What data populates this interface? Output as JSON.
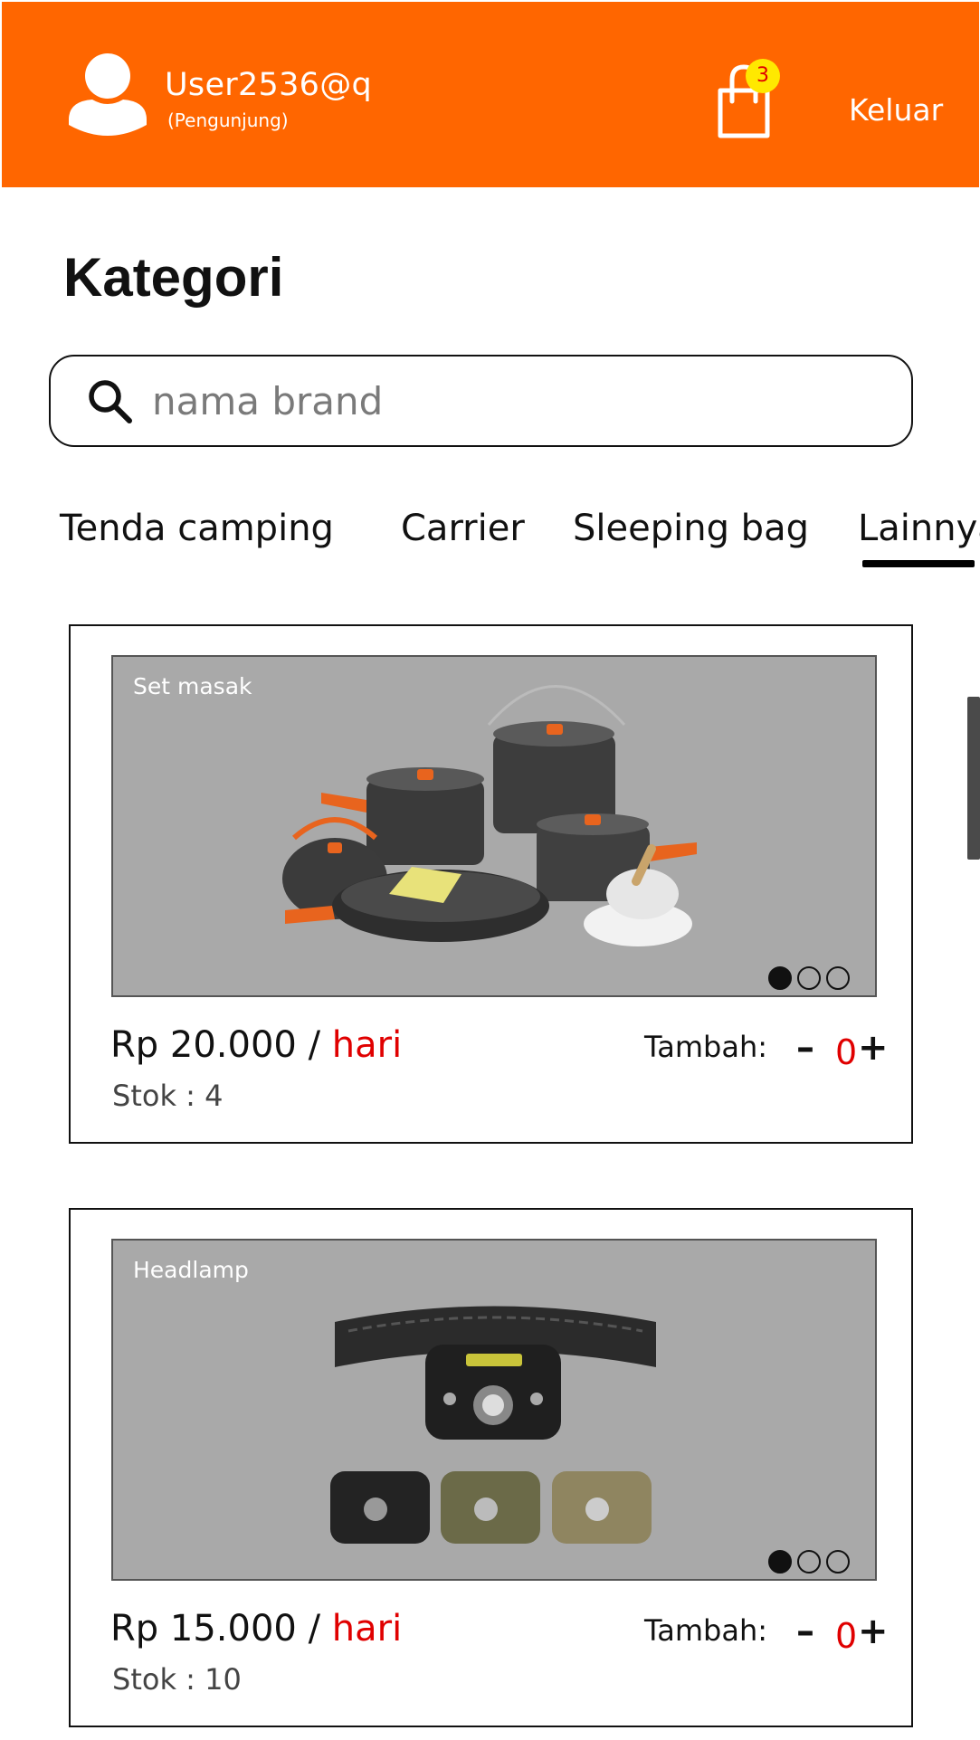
{
  "header": {
    "username": "User2536@q",
    "role": "(Pengunjung)",
    "cart_count": "3",
    "logout_label": "Keluar",
    "background_color": "#ff6600"
  },
  "page_title": "Kategori",
  "search": {
    "placeholder": "nama brand",
    "value": ""
  },
  "tabs": [
    {
      "label": "Tenda camping"
    },
    {
      "label": "Carrier"
    },
    {
      "label": "Sleeping bag"
    },
    {
      "label": "Lainnya",
      "active": true
    }
  ],
  "products": [
    {
      "image_label": "Set masak",
      "image_icon": "cookware-set-photo",
      "price_prefix": "Rp 20.000 / ",
      "price_unit": "hari",
      "stock": "Stok : 4",
      "add_label": "Tambah:",
      "minus": "–",
      "plus": "+",
      "quantity": "0",
      "slide_active": 1,
      "slide_count": 3
    },
    {
      "image_label": "Headlamp",
      "image_icon": "headlamp-photo",
      "price_prefix": "Rp 15.000 / ",
      "price_unit": "hari",
      "stock": "Stok : 10",
      "add_label": "Tambah:",
      "minus": "–",
      "plus": "+",
      "quantity": "0",
      "slide_active": 1,
      "slide_count": 3
    }
  ],
  "colors": {
    "accent": "#ff6600",
    "price_unit": "#e00000",
    "badge": "#ffe800"
  }
}
